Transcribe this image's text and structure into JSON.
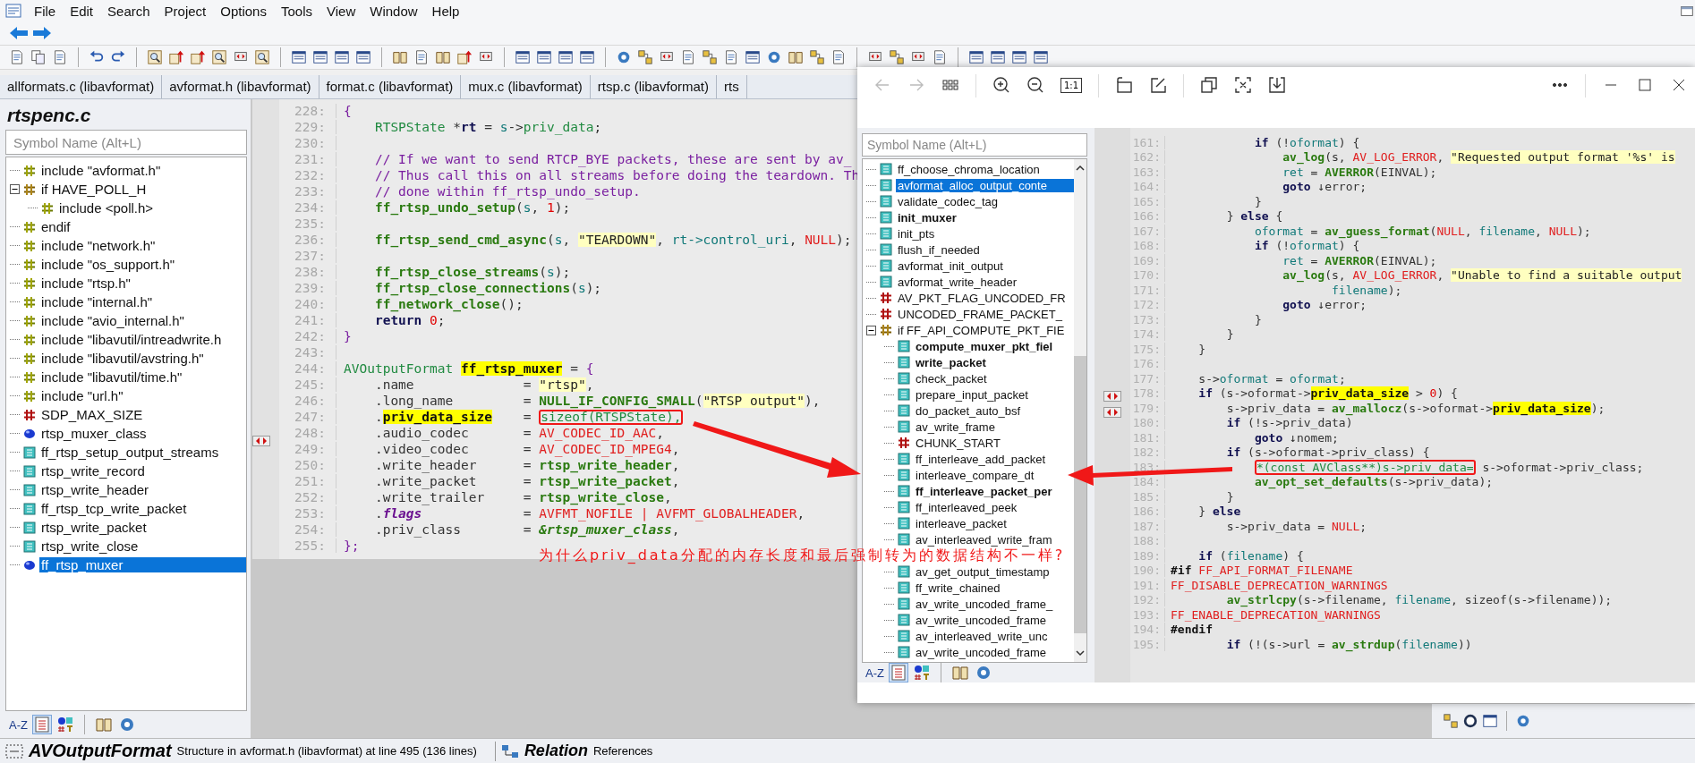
{
  "menu": [
    "File",
    "Edit",
    "Search",
    "Project",
    "Options",
    "Tools",
    "View",
    "Window",
    "Help"
  ],
  "tabs": [
    "allformats.c (libavformat)",
    "avformat.h (libavformat)",
    "format.c (libavformat)",
    "mux.c (libavformat)",
    "rtsp.c (libavformat)",
    "rts"
  ],
  "sidebar": {
    "title": "rtspenc.c",
    "search": {
      "placeholder": "Symbol Name (Alt+L)"
    },
    "sort_label": "A-Z",
    "items": [
      {
        "label": "include \"avformat.h\"",
        "kind": "include",
        "selected": false
      },
      {
        "label": "if HAVE_POLL_H",
        "kind": "ifdef",
        "selected": false,
        "expanded": true,
        "children": [
          {
            "label": "include <poll.h>",
            "kind": "include",
            "selected": false
          }
        ]
      },
      {
        "label": "endif",
        "kind": "include",
        "selected": false
      },
      {
        "label": "include \"network.h\"",
        "kind": "include",
        "selected": false
      },
      {
        "label": "include \"os_support.h\"",
        "kind": "include",
        "selected": false
      },
      {
        "label": "include \"rtsp.h\"",
        "kind": "include",
        "selected": false
      },
      {
        "label": "include \"internal.h\"",
        "kind": "include",
        "selected": false
      },
      {
        "label": "include \"avio_internal.h\"",
        "kind": "include",
        "selected": false
      },
      {
        "label": "include \"libavutil/intreadwrite.h",
        "kind": "include",
        "selected": false
      },
      {
        "label": "include \"libavutil/avstring.h\"",
        "kind": "include",
        "selected": false
      },
      {
        "label": "include \"libavutil/time.h\"",
        "kind": "include",
        "selected": false
      },
      {
        "label": "include \"url.h\"",
        "kind": "include",
        "selected": false
      },
      {
        "label": "SDP_MAX_SIZE",
        "kind": "macro",
        "selected": false
      },
      {
        "label": "rtsp_muxer_class",
        "kind": "var",
        "selected": false
      },
      {
        "label": "ff_rtsp_setup_output_streams",
        "kind": "func",
        "selected": false
      },
      {
        "label": "rtsp_write_record",
        "kind": "func",
        "selected": false
      },
      {
        "label": "rtsp_write_header",
        "kind": "func",
        "selected": false
      },
      {
        "label": "ff_rtsp_tcp_write_packet",
        "kind": "func",
        "selected": false
      },
      {
        "label": "rtsp_write_packet",
        "kind": "func",
        "selected": false
      },
      {
        "label": "rtsp_write_close",
        "kind": "func",
        "selected": false
      },
      {
        "label": "ff_rtsp_muxer",
        "kind": "var",
        "selected": true
      }
    ]
  },
  "editor": {
    "lines": [
      {
        "number": "228:",
        "tokens": [
          {
            "kind": "brace",
            "text": "{"
          }
        ]
      },
      {
        "number": "229:",
        "tokens": [
          {
            "kind": "type",
            "text": "    RTSPState "
          },
          {
            "kind": "p",
            "text": "*"
          },
          {
            "kind": "kw",
            "text": "rt"
          },
          {
            "kind": "p",
            "text": " = "
          },
          {
            "kind": "var",
            "text": "s"
          },
          {
            "kind": "p",
            "text": "->"
          },
          {
            "kind": "type",
            "text": "priv_data"
          },
          {
            "kind": "p",
            "text": ";"
          }
        ]
      },
      {
        "number": "230:"
      },
      {
        "number": "231:",
        "tokens": [
          {
            "kind": "cm",
            "text": "    // If we want to send RTCP_BYE packets, these are sent by av_"
          }
        ]
      },
      {
        "number": "232:",
        "tokens": [
          {
            "kind": "cm",
            "text": "    // Thus call this on all streams before doing the teardown. Th"
          }
        ]
      },
      {
        "number": "233:",
        "tokens": [
          {
            "kind": "cm",
            "text": "    // done within ff_rtsp_undo_setup."
          }
        ]
      },
      {
        "number": "234:",
        "tokens": [
          {
            "kind": "fn",
            "text": "    ff_rtsp_undo_setup"
          },
          {
            "kind": "p",
            "text": "("
          },
          {
            "kind": "var",
            "text": "s"
          },
          {
            "kind": "p",
            "text": ", "
          },
          {
            "kind": "num",
            "text": "1"
          },
          {
            "kind": "p",
            "text": ");"
          }
        ]
      },
      {
        "number": "235:"
      },
      {
        "number": "236:",
        "tokens": [
          {
            "kind": "fn",
            "text": "    ff_rtsp_send_cmd_async"
          },
          {
            "kind": "p",
            "text": "("
          },
          {
            "kind": "var",
            "text": "s"
          },
          {
            "kind": "p",
            "text": ", "
          },
          {
            "kind": "str",
            "text": "\"TEARDOWN\""
          },
          {
            "kind": "p",
            "text": ", "
          },
          {
            "kind": "var",
            "text": "rt->control_uri"
          },
          {
            "kind": "p",
            "text": ", "
          },
          {
            "kind": "const",
            "text": "NULL"
          },
          {
            "kind": "p",
            "text": ");"
          }
        ]
      },
      {
        "number": "237:"
      },
      {
        "number": "238:",
        "tokens": [
          {
            "kind": "fn",
            "text": "    ff_rtsp_close_streams"
          },
          {
            "kind": "p",
            "text": "("
          },
          {
            "kind": "var",
            "text": "s"
          },
          {
            "kind": "p",
            "text": ");"
          }
        ]
      },
      {
        "number": "239:",
        "tokens": [
          {
            "kind": "fn",
            "text": "    ff_rtsp_close_connections"
          },
          {
            "kind": "p",
            "text": "("
          },
          {
            "kind": "var",
            "text": "s"
          },
          {
            "kind": "p",
            "text": ");"
          }
        ]
      },
      {
        "number": "240:",
        "tokens": [
          {
            "kind": "fn",
            "text": "    ff_network_close"
          },
          {
            "kind": "p",
            "text": "();"
          }
        ]
      },
      {
        "number": "241:",
        "tokens": [
          {
            "kind": "kw",
            "text": "    return"
          },
          {
            "kind": "num",
            "text": " 0"
          },
          {
            "kind": "p",
            "text": ";"
          }
        ]
      },
      {
        "number": "242:",
        "tokens": [
          {
            "kind": "brace",
            "text": "}"
          }
        ]
      },
      {
        "number": "243:"
      },
      {
        "number": "244:",
        "tokens": [
          {
            "kind": "type",
            "text": "AVOutputFormat "
          },
          {
            "kind": "hl",
            "text": "ff_rtsp_muxer"
          },
          {
            "kind": "p",
            "text": " = "
          },
          {
            "kind": "brace",
            "text": "{"
          }
        ]
      },
      {
        "number": "245:",
        "tokens": [
          {
            "kind": "p",
            "text": "    .name              = "
          },
          {
            "kind": "str",
            "text": "\"rtsp\""
          },
          {
            "kind": "p",
            "text": ","
          }
        ]
      },
      {
        "number": "246:",
        "tokens": [
          {
            "kind": "p",
            "text": "    .long_name         = "
          },
          {
            "kind": "fn",
            "text": "NULL_IF_CONFIG_SMALL"
          },
          {
            "kind": "p",
            "text": "("
          },
          {
            "kind": "str",
            "text": "\"RTSP output\""
          },
          {
            "kind": "p",
            "text": "),"
          }
        ]
      },
      {
        "number": "247:",
        "tokens": [
          {
            "kind": "p",
            "text": "    ."
          },
          {
            "kind": "hl",
            "text": "priv_data_size"
          },
          {
            "kind": "p",
            "text": "    = "
          },
          {
            "kind": "box",
            "text": "sizeof(RTSPState),"
          }
        ]
      },
      {
        "number": "248:",
        "tokens": [
          {
            "kind": "p",
            "text": "    .audio_codec       = "
          },
          {
            "kind": "const",
            "text": "AV_CODEC_ID_AAC"
          },
          {
            "kind": "p",
            "text": ","
          }
        ]
      },
      {
        "number": "249:",
        "tokens": [
          {
            "kind": "p",
            "text": "    .video_codec       = "
          },
          {
            "kind": "const",
            "text": "AV_CODEC_ID_MPEG4"
          },
          {
            "kind": "p",
            "text": ","
          }
        ]
      },
      {
        "number": "250:",
        "tokens": [
          {
            "kind": "p",
            "text": "    .write_header      = "
          },
          {
            "kind": "fn",
            "text": "rtsp_write_header"
          },
          {
            "kind": "p",
            "text": ","
          }
        ]
      },
      {
        "number": "251:",
        "tokens": [
          {
            "kind": "p",
            "text": "    .write_packet      = "
          },
          {
            "kind": "fn",
            "text": "rtsp_write_packet"
          },
          {
            "kind": "p",
            "text": ","
          }
        ]
      },
      {
        "number": "252:",
        "tokens": [
          {
            "kind": "p",
            "text": "    .write_trailer     = "
          },
          {
            "kind": "fn",
            "text": "rtsp_write_close"
          },
          {
            "kind": "p",
            "text": ","
          }
        ]
      },
      {
        "number": "253:",
        "tokens": [
          {
            "kind": "p",
            "text": "    ."
          },
          {
            "kind": "it",
            "text": "flags"
          },
          {
            "kind": "p",
            "text": "             = "
          },
          {
            "kind": "const",
            "text": "AVFMT_NOFILE | AVFMT_GLOBALHEADER"
          },
          {
            "kind": "p",
            "text": ","
          }
        ]
      },
      {
        "number": "254:",
        "tokens": [
          {
            "kind": "p",
            "text": "    .priv_class        = "
          },
          {
            "kind": "itg",
            "text": "&rtsp_muxer_class"
          },
          {
            "kind": "p",
            "text": ","
          }
        ]
      },
      {
        "number": "255:",
        "tokens": [
          {
            "kind": "brace",
            "text": "};"
          }
        ]
      }
    ]
  },
  "viewer": {
    "nav_buttons": [
      {
        "disabled": true
      },
      {
        "disabled": true
      }
    ],
    "actual_size_label": "1:1",
    "sidebar": {
      "search": {
        "placeholder": "Symbol Name (Alt+L)"
      },
      "sort_label": "A-Z",
      "items": [
        {
          "label": "ff_choose_chroma_location",
          "kind": "func",
          "bold": false,
          "selected": false
        },
        {
          "label": "avformat_alloc_output_conte",
          "kind": "func",
          "bold": false,
          "selected": true
        },
        {
          "label": "validate_codec_tag",
          "kind": "func",
          "bold": false,
          "selected": false
        },
        {
          "label": "init_muxer",
          "kind": "func",
          "bold": true,
          "selected": false
        },
        {
          "label": "init_pts",
          "kind": "func",
          "bold": false,
          "selected": false
        },
        {
          "label": "flush_if_needed",
          "kind": "func",
          "bold": false,
          "selected": false
        },
        {
          "label": "avformat_init_output",
          "kind": "func",
          "bold": false,
          "selected": false
        },
        {
          "label": "avformat_write_header",
          "kind": "func",
          "bold": false,
          "selected": false
        },
        {
          "label": "AV_PKT_FLAG_UNCODED_FR",
          "kind": "macro",
          "bold": false,
          "selected": false
        },
        {
          "label": "UNCODED_FRAME_PACKET_",
          "kind": "macro",
          "bold": false,
          "selected": false
        },
        {
          "label": "if FF_API_COMPUTE_PKT_FIE",
          "kind": "ifdef",
          "bold": false,
          "selected": false,
          "expanded": true,
          "children": [
            {
              "label": "compute_muxer_pkt_fiel",
              "kind": "func",
              "bold": true,
              "selected": false
            },
            {
              "label": "write_packet",
              "kind": "func",
              "bold": true,
              "selected": false
            },
            {
              "label": "check_packet",
              "kind": "func",
              "bold": false,
              "selected": false
            },
            {
              "label": "prepare_input_packet",
              "kind": "func",
              "bold": false,
              "selected": false
            },
            {
              "label": "do_packet_auto_bsf",
              "kind": "func",
              "bold": false,
              "selected": false
            },
            {
              "label": "av_write_frame",
              "kind": "func",
              "bold": false,
              "selected": false
            },
            {
              "label": "CHUNK_START",
              "kind": "macro",
              "bold": false,
              "selected": false
            },
            {
              "label": "ff_interleave_add_packet",
              "kind": "func",
              "bold": false,
              "selected": false
            },
            {
              "label": "interleave_compare_dt",
              "kind": "func",
              "bold": false,
              "selected": false
            },
            {
              "label": "ff_interleave_packet_per",
              "kind": "func",
              "bold": true,
              "selected": false
            },
            {
              "label": "ff_interleaved_peek",
              "kind": "func",
              "bold": false,
              "selected": false
            },
            {
              "label": "interleave_packet",
              "kind": "func",
              "bold": false,
              "selected": false
            },
            {
              "label": "av_interleaved_write_fram",
              "kind": "func",
              "bold": false,
              "selected": false
            },
            {
              "kind": "covered"
            },
            {
              "label": "av_get_output_timestamp",
              "kind": "func",
              "bold": false,
              "selected": false
            },
            {
              "label": "ff_write_chained",
              "kind": "func",
              "bold": false,
              "selected": false
            },
            {
              "label": "av_write_uncoded_frame_",
              "kind": "func",
              "bold": false,
              "selected": false
            },
            {
              "label": "av_write_uncoded_frame",
              "kind": "func",
              "bold": false,
              "selected": false
            },
            {
              "label": "av_interleaved_write_unc",
              "kind": "func",
              "bold": false,
              "selected": false
            },
            {
              "label": "av_write_uncoded_frame",
              "kind": "func",
              "bold": false,
              "selected": false
            }
          ]
        }
      ]
    },
    "editor": {
      "lines": [
        {
          "number": "161:",
          "tokens": [
            {
              "kind": "kw",
              "text": "            if"
            },
            {
              "kind": "p",
              "text": " (!"
            },
            {
              "kind": "var",
              "text": "oformat"
            },
            {
              "kind": "p",
              "text": ") {"
            }
          ]
        },
        {
          "number": "162:",
          "tokens": [
            {
              "kind": "fn",
              "text": "                av_log"
            },
            {
              "kind": "p",
              "text": "(s, "
            },
            {
              "kind": "const",
              "text": "AV_LOG_ERROR"
            },
            {
              "kind": "p",
              "text": ", "
            },
            {
              "kind": "str",
              "text": "\"Requested output format '%s' is"
            }
          ]
        },
        {
          "number": "163:",
          "tokens": [
            {
              "kind": "var",
              "text": "                ret"
            },
            {
              "kind": "p",
              "text": " = "
            },
            {
              "kind": "fn",
              "text": "AVERROR"
            },
            {
              "kind": "p",
              "text": "(EINVAL);"
            }
          ]
        },
        {
          "number": "164:",
          "tokens": [
            {
              "kind": "kw",
              "text": "                goto"
            },
            {
              "kind": "p",
              "text": " ↓error;"
            }
          ]
        },
        {
          "number": "165:",
          "tokens": [
            {
              "kind": "p",
              "text": "            }"
            }
          ]
        },
        {
          "number": "166:",
          "tokens": [
            {
              "kind": "p",
              "text": "        } "
            },
            {
              "kind": "kw",
              "text": "else"
            },
            {
              "kind": "p",
              "text": " {"
            }
          ]
        },
        {
          "number": "167:",
          "tokens": [
            {
              "kind": "var",
              "text": "            oformat"
            },
            {
              "kind": "p",
              "text": " = "
            },
            {
              "kind": "fn",
              "text": "av_guess_format"
            },
            {
              "kind": "p",
              "text": "("
            },
            {
              "kind": "const",
              "text": "NULL"
            },
            {
              "kind": "p",
              "text": ", "
            },
            {
              "kind": "var",
              "text": "filename"
            },
            {
              "kind": "p",
              "text": ", "
            },
            {
              "kind": "const",
              "text": "NULL"
            },
            {
              "kind": "p",
              "text": ");"
            }
          ]
        },
        {
          "number": "168:",
          "tokens": [
            {
              "kind": "kw",
              "text": "            if"
            },
            {
              "kind": "p",
              "text": " (!"
            },
            {
              "kind": "var",
              "text": "oformat"
            },
            {
              "kind": "p",
              "text": ") {"
            }
          ]
        },
        {
          "number": "169:",
          "tokens": [
            {
              "kind": "var",
              "text": "                ret"
            },
            {
              "kind": "p",
              "text": " = "
            },
            {
              "kind": "fn",
              "text": "AVERROR"
            },
            {
              "kind": "p",
              "text": "(EINVAL);"
            }
          ]
        },
        {
          "number": "170:",
          "tokens": [
            {
              "kind": "fn",
              "text": "                av_log"
            },
            {
              "kind": "p",
              "text": "(s, "
            },
            {
              "kind": "const",
              "text": "AV_LOG_ERROR"
            },
            {
              "kind": "p",
              "text": ", "
            },
            {
              "kind": "str",
              "text": "\"Unable to find a suitable output"
            }
          ]
        },
        {
          "number": "171:",
          "tokens": [
            {
              "kind": "var",
              "text": "                       filename"
            },
            {
              "kind": "p",
              "text": ");"
            }
          ]
        },
        {
          "number": "172:",
          "tokens": [
            {
              "kind": "kw",
              "text": "                goto"
            },
            {
              "kind": "p",
              "text": " ↓error;"
            }
          ]
        },
        {
          "number": "173:",
          "tokens": [
            {
              "kind": "p",
              "text": "            }"
            }
          ]
        },
        {
          "number": "174:",
          "tokens": [
            {
              "kind": "p",
              "text": "        }"
            }
          ]
        },
        {
          "number": "175:",
          "tokens": [
            {
              "kind": "p",
              "text": "    }"
            }
          ]
        },
        {
          "number": "176:"
        },
        {
          "number": "177:",
          "tokens": [
            {
              "kind": "p",
              "text": "    s->"
            },
            {
              "kind": "var",
              "text": "oformat"
            },
            {
              "kind": "p",
              "text": " = "
            },
            {
              "kind": "var",
              "text": "oformat"
            },
            {
              "kind": "p",
              "text": ";"
            }
          ]
        },
        {
          "number": "178:",
          "tokens": [
            {
              "kind": "kw",
              "text": "    if"
            },
            {
              "kind": "p",
              "text": " (s->oformat->"
            },
            {
              "kind": "hl",
              "text": "priv_data_size"
            },
            {
              "kind": "p",
              "text": " > "
            },
            {
              "kind": "num",
              "text": "0"
            },
            {
              "kind": "p",
              "text": ") {"
            }
          ]
        },
        {
          "number": "179:",
          "tokens": [
            {
              "kind": "p",
              "text": "        s->priv_data = "
            },
            {
              "kind": "fn",
              "text": "av_mallocz"
            },
            {
              "kind": "p",
              "text": "(s->oformat->"
            },
            {
              "kind": "hl",
              "text": "priv_data_size"
            },
            {
              "kind": "p",
              "text": ");"
            }
          ]
        },
        {
          "number": "180:",
          "tokens": [
            {
              "kind": "kw",
              "text": "        if"
            },
            {
              "kind": "p",
              "text": " (!s->priv_data)"
            }
          ]
        },
        {
          "number": "181:",
          "tokens": [
            {
              "kind": "kw",
              "text": "            goto"
            },
            {
              "kind": "p",
              "text": " ↓nomem;"
            }
          ]
        },
        {
          "number": "182:",
          "tokens": [
            {
              "kind": "kw",
              "text": "        if"
            },
            {
              "kind": "p",
              "text": " (s->oformat->priv_class) {"
            }
          ]
        },
        {
          "number": "183:",
          "tokens": [
            {
              "kind": "box",
              "text": "            *(const AVClass**)s->priv_data="
            },
            {
              "kind": "p",
              "text": " s->oformat->priv_class;"
            }
          ]
        },
        {
          "number": "184:",
          "tokens": [
            {
              "kind": "fn",
              "text": "            av_opt_set_defaults"
            },
            {
              "kind": "p",
              "text": "(s->priv_data);"
            }
          ]
        },
        {
          "number": "185:",
          "tokens": [
            {
              "kind": "p",
              "text": "        }"
            }
          ]
        },
        {
          "number": "186:",
          "tokens": [
            {
              "kind": "p",
              "text": "    } "
            },
            {
              "kind": "kw",
              "text": "else"
            }
          ]
        },
        {
          "number": "187:",
          "tokens": [
            {
              "kind": "p",
              "text": "        s->priv_data = "
            },
            {
              "kind": "const",
              "text": "NULL"
            },
            {
              "kind": "p",
              "text": ";"
            }
          ]
        },
        {
          "number": "188:"
        },
        {
          "number": "189:",
          "tokens": [
            {
              "kind": "kw",
              "text": "    if"
            },
            {
              "kind": "p",
              "text": " ("
            },
            {
              "kind": "var",
              "text": "filename"
            },
            {
              "kind": "p",
              "text": ") {"
            }
          ]
        },
        {
          "number": "190:",
          "tokens": [
            {
              "kind": "pp",
              "text": "#if"
            },
            {
              "kind": "const",
              "text": " FF_API_FORMAT_FILENAME"
            }
          ]
        },
        {
          "number": "191:",
          "tokens": [
            {
              "kind": "const",
              "text": "FF_DISABLE_DEPRECATION_WARNINGS"
            }
          ]
        },
        {
          "number": "192:",
          "tokens": [
            {
              "kind": "fn",
              "text": "        av_strlcpy"
            },
            {
              "kind": "p",
              "text": "(s->filename, "
            },
            {
              "kind": "var",
              "text": "filename"
            },
            {
              "kind": "p",
              "text": ", sizeof(s->filename));"
            }
          ]
        },
        {
          "number": "193:",
          "tokens": [
            {
              "kind": "const",
              "text": "FF_ENABLE_DEPRECATION_WARNINGS"
            }
          ]
        },
        {
          "number": "194:",
          "tokens": [
            {
              "kind": "pp",
              "text": "#endif"
            }
          ]
        },
        {
          "number": "195:",
          "tokens": [
            {
              "kind": "kw",
              "text": "        if"
            },
            {
              "kind": "p",
              "text": " (!(s->url = "
            },
            {
              "kind": "fn",
              "text": "av_strdup"
            },
            {
              "kind": "p",
              "text": "("
            },
            {
              "kind": "var",
              "text": "filename"
            },
            {
              "kind": "p",
              "text": "))"
            }
          ]
        }
      ]
    }
  },
  "annotation": {
    "text": "为什么priv_data分配的内存长度和最后强制转为的数据结构不一样?"
  },
  "status_bar": {
    "symbol": "AVOutputFormat",
    "description": "Structure in avformat.h (libavformat) at line 495 (136 lines)",
    "panel_title": "Relation",
    "panel_tab": "References"
  }
}
